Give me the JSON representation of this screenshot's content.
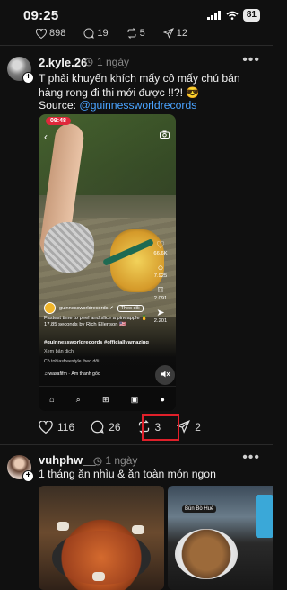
{
  "status_bar": {
    "time": "09:25",
    "battery": "81"
  },
  "prev_post": {
    "likes": "898",
    "comments": "19",
    "reposts": "5",
    "shares": "12"
  },
  "post1": {
    "username": "2.kyle.26",
    "time": "1 ngày",
    "caption": "T phải khuyến khích mấy cô mấy chú bán hàng rong đi thi mới được !!?! 😎",
    "source_label": "Source: ",
    "source_link": "@guinnessworldrecords",
    "video": {
      "badge": "09:48",
      "account": "guinnessworldrecords ✔",
      "follow": "Theo dõi",
      "desc": "Fastest time to peel and slice a pineapple 🍍 17.85 seconds by Rich Ellenson 🇺🇸",
      "tags": "#guinnessworldrecords #officiallyamazing",
      "translate": "Xem bản dịch",
      "followed_by": "Có tobiasfreestyle theo dõi",
      "audio": "♫ wasafifm · Âm thanh gốc",
      "likes": "66,6K",
      "comments": "7.925",
      "saves": "2.091",
      "shares": "2.201"
    },
    "likes": "116",
    "comments": "26",
    "reposts": "3",
    "shares": "2"
  },
  "post2": {
    "username": "vuhphw__",
    "time": "1 ngày",
    "caption": "1 tháng ăn nhìu & ăn toàn món ngon",
    "image_b_sign": "Bún Bò Huế"
  },
  "colors": {
    "background": "#101010",
    "link": "#4aa3ff",
    "highlight": "#e0202a"
  },
  "icons": [
    "signal-icon",
    "wifi-icon",
    "heart-icon",
    "comment-icon",
    "repost-icon",
    "share-icon",
    "more-icon",
    "verified-icon"
  ]
}
